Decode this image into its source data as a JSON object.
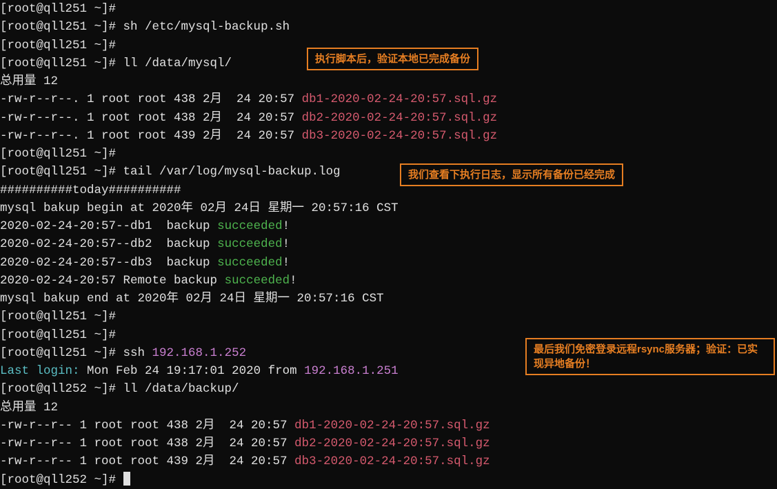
{
  "lines": {
    "p1": "[root@qll251 ~]#",
    "p2_prompt": "[root@qll251 ~]# ",
    "p2_cmd": "sh /etc/mysql-backup.sh",
    "p3": "[root@qll251 ~]#",
    "p4_prompt": "[root@qll251 ~]# ",
    "p4_cmd": "ll /data/mysql/",
    "total1": "总用量 12",
    "f1_meta": "-rw-r--r--. 1 root root 438 2月  24 20:57 ",
    "f1_name": "db1-2020-02-24-20:57.sql.gz",
    "f2_meta": "-rw-r--r--. 1 root root 438 2月  24 20:57 ",
    "f2_name": "db2-2020-02-24-20:57.sql.gz",
    "f3_meta": "-rw-r--r--. 1 root root 439 2月  24 20:57 ",
    "f3_name": "db3-2020-02-24-20:57.sql.gz",
    "p5": "[root@qll251 ~]#",
    "p6_prompt": "[root@qll251 ~]# ",
    "p6_cmd": "tail /var/log/mysql-backup.log",
    "sep": "##########today##########",
    "begin": "mysql bakup begin at 2020年 02月 24日 星期一 20:57:16 CST",
    "b1_pre": "2020-02-24-20:57--db1  backup ",
    "b1_status": "succeeded",
    "b1_post": "!",
    "b2_pre": "2020-02-24-20:57--db2  backup ",
    "b2_status": "succeeded",
    "b2_post": "!",
    "b3_pre": "2020-02-24-20:57--db3  backup ",
    "b3_status": "succeeded",
    "b3_post": "!",
    "remote_pre": "2020-02-24-20:57 Remote backup ",
    "remote_status": "succeeded",
    "remote_post": "!",
    "end": "mysql bakup end at 2020年 02月 24日 星期一 20:57:16 CST",
    "p7": "[root@qll251 ~]#",
    "p8": "[root@qll251 ~]#",
    "p9_prompt": "[root@qll251 ~]# ",
    "p9_cmd": "ssh ",
    "p9_ip": "192.168.1.252",
    "login_label": "Last login:",
    "login_text": " Mon Feb 24 19:17:01 2020 from ",
    "login_ip": "192.168.1.251",
    "p10_prompt": "[root@qll252 ~]# ",
    "p10_cmd": "ll /data/backup/",
    "total2": "总用量 12",
    "g1_meta": "-rw-r--r-- 1 root root 438 2月  24 20:57 ",
    "g1_name": "db1-2020-02-24-20:57.sql.gz",
    "g2_meta": "-rw-r--r-- 1 root root 438 2月  24 20:57 ",
    "g2_name": "db2-2020-02-24-20:57.sql.gz",
    "g3_meta": "-rw-r--r-- 1 root root 439 2月  24 20:57 ",
    "g3_name": "db3-2020-02-24-20:57.sql.gz",
    "p11": "[root@qll252 ~]# "
  },
  "annotations": {
    "a1": "执行脚本后，验证本地已完成备份",
    "a2": "我们查看下执行日志，显示所有备份已经完成",
    "a3": "最后我们免密登录远程rsync服务器；验证：已实现异地备份！"
  }
}
